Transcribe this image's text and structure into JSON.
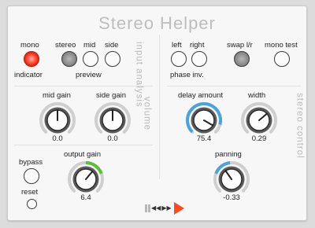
{
  "app": {
    "title": "Stereo Helper"
  },
  "sections": {
    "input_analysis": "input analysis",
    "volume": "volume",
    "stereo_control": "stereo control"
  },
  "input": {
    "mono_label": "mono",
    "indicator_label": "indicator",
    "stereo_label": "stereo",
    "mid_label": "mid",
    "side_label": "side",
    "preview_label": "preview"
  },
  "phase": {
    "left_label": "left",
    "right_label": "right",
    "phase_inv_label": "phase inv.",
    "swap_label": "swap l/r",
    "mono_test_label": "mono test"
  },
  "knobs": {
    "mid_gain": {
      "label": "mid gain",
      "value": "0.0"
    },
    "side_gain": {
      "label": "side gain",
      "value": "0.0"
    },
    "output_gain": {
      "label": "output gain",
      "value": "6.4"
    },
    "delay_amount": {
      "label": "delay amount",
      "value": "75.4"
    },
    "width": {
      "label": "width",
      "value": "0.29"
    },
    "panning": {
      "label": "panning",
      "value": "-0.33"
    }
  },
  "misc": {
    "bypass_label": "bypass",
    "reset_label": "reset"
  },
  "colors": {
    "accent_red": "#ff4a1c",
    "arc_blue": "#4aa3df",
    "arc_green": "#5cbf3a",
    "label_gray": "#b9b9b9"
  },
  "icons": [
    "transport-bars-icon",
    "rewind-icon",
    "forward-icon",
    "play-icon"
  ]
}
